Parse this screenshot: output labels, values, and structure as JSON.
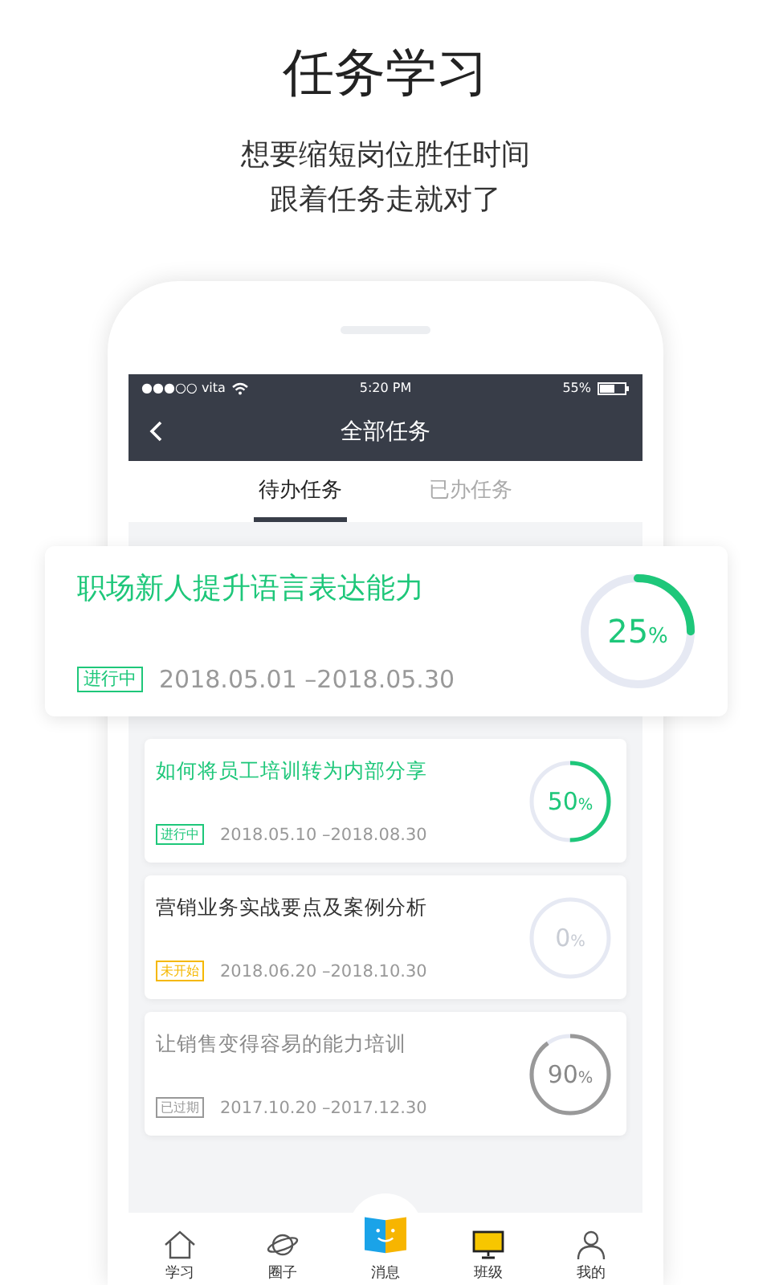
{
  "headline": {
    "title": "任务学习",
    "subtitle_lines": [
      "想要缩短岗位胜任时间",
      "跟着任务走就对了"
    ]
  },
  "status_bar": {
    "carrier": "●●●○○ vita",
    "time": "5:20 PM",
    "battery": "55%"
  },
  "nav_bar": {
    "title": "全部任务"
  },
  "tabs": [
    {
      "label": "待办任务",
      "selected": true
    },
    {
      "label": "已办任务",
      "selected": false
    }
  ],
  "featured_task": {
    "title": "职场新人提升语言表达能力",
    "kind": "ongoing",
    "status": "进行中",
    "dates": "2018.05.01 –2018.05.30",
    "percent": "25",
    "unit": "%",
    "level": 0.25
  },
  "tasks": [
    {
      "title": "如何将员工培训转为内部分享",
      "kind": "ongoing",
      "status": "进行中",
      "dates": "2018.05.10 –2018.08.30",
      "percent": "50",
      "unit": "%",
      "level": 0.5
    },
    {
      "title": "营销业务实战要点及案例分析",
      "kind": "pending",
      "status": "未开始",
      "dates": "2018.06.20 –2018.10.30",
      "percent": "0",
      "unit": "%",
      "level": 0
    },
    {
      "title": "让销售变得容易的能力培训",
      "kind": "expired",
      "status": "已过期",
      "dates": "2017.10.20 –2017.12.30",
      "percent": "90",
      "unit": "%",
      "level": 0.9
    }
  ],
  "bottom_nav": [
    {
      "label": "学习",
      "kind": "home"
    },
    {
      "label": "圈子",
      "kind": "planet"
    },
    {
      "label": "消息",
      "kind": "book"
    },
    {
      "label": "班级",
      "kind": "monitor"
    },
    {
      "label": "我的",
      "kind": "person"
    }
  ]
}
